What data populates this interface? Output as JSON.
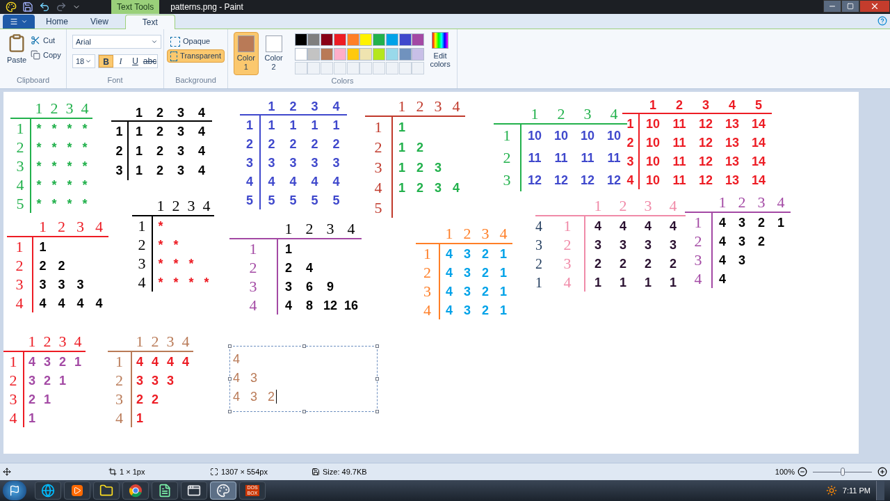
{
  "title_bar": {
    "title": "patterns.png - Paint",
    "context_tab": "Text Tools"
  },
  "tabs": [
    {
      "label": "Home",
      "selected": false
    },
    {
      "label": "View",
      "selected": false
    },
    {
      "label": "Text",
      "selected": true
    }
  ],
  "clipboard": {
    "label": "Clipboard",
    "paste": "Paste",
    "cut": "Cut",
    "copy": "Copy"
  },
  "font": {
    "label": "Font",
    "family": "Arial",
    "size": "18",
    "styles": [
      {
        "kind": "bold",
        "label": "B",
        "selected": true
      },
      {
        "kind": "italic",
        "label": "I",
        "selected": false
      },
      {
        "kind": "underline",
        "label": "U",
        "selected": false
      },
      {
        "kind": "strike",
        "label": "abc",
        "selected": false
      }
    ]
  },
  "background": {
    "label": "Background",
    "options": [
      {
        "label": "Opaque",
        "selected": false
      },
      {
        "label": "Transparent",
        "selected": true
      }
    ]
  },
  "colors": {
    "label": "Colors",
    "slots": [
      {
        "label": "Color 1",
        "color": "#b97a57",
        "selected": true
      },
      {
        "label": "Color 2",
        "color": "#ffffff",
        "selected": false
      }
    ],
    "palette": [
      {
        "color": "#000000"
      },
      {
        "color": "#7f7f7f"
      },
      {
        "color": "#880015"
      },
      {
        "color": "#ed1c24"
      },
      {
        "color": "#ff7f27"
      },
      {
        "color": "#fff200"
      },
      {
        "color": "#22b14c"
      },
      {
        "color": "#00a2e8"
      },
      {
        "color": "#3f48cc"
      },
      {
        "color": "#a349a4"
      },
      {
        "color": "#ffffff"
      },
      {
        "color": "#c3c3c3"
      },
      {
        "color": "#b97a57"
      },
      {
        "color": "#ffaec9"
      },
      {
        "color": "#ffc90e"
      },
      {
        "color": "#efe4b0"
      },
      {
        "color": "#b5e61d"
      },
      {
        "color": "#99d9ea"
      },
      {
        "color": "#7092be"
      },
      {
        "color": "#c8bfe7"
      }
    ],
    "edit": "Edit colors"
  },
  "canvas": {
    "patterns": [
      {
        "kind": "handwritten",
        "header": {
          "color": "#22b14c",
          "labels": [
            "1",
            "2",
            "3",
            "4"
          ]
        },
        "labels": {
          "color": "#22b14c",
          "labels": [
            "1",
            "2",
            "3",
            "4",
            "5"
          ]
        },
        "color": "#22b14c",
        "rows": [
          [
            "*",
            "*",
            "*",
            "*"
          ],
          [
            "*",
            "*",
            "*",
            "*"
          ],
          [
            "*",
            "*",
            "*",
            "*"
          ],
          [
            "*",
            "*",
            "*",
            "*"
          ],
          [
            "*",
            "*",
            "*",
            "*"
          ]
        ]
      },
      {
        "kind": "typed",
        "header": {
          "color": "#000000",
          "labels": [
            "1",
            "2",
            "3",
            "4"
          ]
        },
        "labels": {
          "color": "#000000",
          "labels": [
            "1",
            "2",
            "3"
          ]
        },
        "color": "#000000",
        "rows": [
          [
            "1",
            "2",
            "3",
            "4"
          ],
          [
            "1",
            "2",
            "3",
            "4"
          ],
          [
            "1",
            "2",
            "3",
            "4"
          ]
        ]
      },
      {
        "kind": "typed",
        "header": {
          "color": "#3f48cc",
          "labels": [
            "1",
            "2",
            "3",
            "4"
          ]
        },
        "labels": {
          "color": "#3f48cc",
          "labels": [
            "1",
            "2",
            "3",
            "4",
            "5"
          ]
        },
        "color": "#3f48cc",
        "rows": [
          [
            "1",
            "1",
            "1",
            "1"
          ],
          [
            "2",
            "2",
            "2",
            "2"
          ],
          [
            "3",
            "3",
            "3",
            "3"
          ],
          [
            "4",
            "4",
            "4",
            "4"
          ],
          [
            "5",
            "5",
            "5",
            "5"
          ]
        ]
      },
      {
        "kind": "handwritten",
        "header": {
          "color": "#c0392b",
          "labels": [
            "1",
            "2",
            "3",
            "4"
          ]
        },
        "labels": {
          "color": "#c0392b",
          "labels": [
            "1",
            "2",
            "3",
            "4",
            "5"
          ]
        },
        "color": "#22b14c",
        "rows": [
          [
            "1"
          ],
          [
            "1",
            "2"
          ],
          [
            "1",
            "2",
            "3"
          ],
          [
            "1",
            "2",
            "3",
            "4"
          ]
        ]
      },
      {
        "kind": "handwritten",
        "header": {
          "color": "#22b14c",
          "labels": [
            "1",
            "2",
            "3",
            "4"
          ]
        },
        "labels": {
          "color": "#22b14c",
          "labels": [
            "1",
            "2",
            "3"
          ]
        },
        "color": "#3f48cc",
        "rows": [
          [
            "10",
            "10",
            "10",
            "10"
          ],
          [
            "11",
            "11",
            "11",
            "11"
          ],
          [
            "12",
            "12",
            "12",
            "12"
          ]
        ]
      },
      {
        "kind": "typed",
        "header": {
          "color": "#ed1c24",
          "labels": [
            "1",
            "2",
            "3",
            "4",
            "5"
          ]
        },
        "labels": {
          "color": "#ed1c24",
          "labels": [
            "1",
            "2",
            "3",
            "4"
          ]
        },
        "color": "#ed1c24",
        "rows": [
          [
            "10",
            "11",
            "12",
            "13",
            "14"
          ],
          [
            "10",
            "11",
            "12",
            "13",
            "14"
          ],
          [
            "10",
            "11",
            "12",
            "13",
            "14"
          ],
          [
            "10",
            "11",
            "12",
            "13",
            "14"
          ]
        ]
      },
      {
        "kind": "handwritten",
        "header": {
          "color": "#ed1c24",
          "labels": [
            "1",
            "2",
            "3",
            "4"
          ]
        },
        "labels": {
          "color": "#ed1c24",
          "labels": [
            "1",
            "2",
            "3",
            "4"
          ]
        },
        "color": "#000000",
        "rows": [
          [
            "1"
          ],
          [
            "2",
            "2"
          ],
          [
            "3",
            "3",
            "3"
          ],
          [
            "4",
            "4",
            "4",
            "4"
          ]
        ]
      },
      {
        "kind": "handwritten",
        "header": {
          "color": "#000000",
          "labels": [
            "1",
            "2",
            "3",
            "4"
          ]
        },
        "labels": {
          "color": "#000000",
          "labels": [
            "1",
            "2",
            "3",
            "4"
          ]
        },
        "color": "#ed1c24",
        "rows": [
          [
            "*"
          ],
          [
            "*",
            "*"
          ],
          [
            "*",
            "*",
            "*"
          ],
          [
            "*",
            "*",
            "*",
            "*"
          ]
        ]
      },
      {
        "kind": "handwritten",
        "header": {
          "color": "#000000",
          "labels": [
            "1",
            "2",
            "3",
            "4"
          ]
        },
        "labels": {
          "color": "#a349a4",
          "labels": [
            "1",
            "2",
            "3",
            "4"
          ]
        },
        "color": "#000000",
        "rows": [
          [
            "1"
          ],
          [
            "2",
            "4"
          ],
          [
            "3",
            "6",
            "9"
          ],
          [
            "4",
            "8",
            "12",
            "16"
          ]
        ]
      },
      {
        "kind": "handwritten",
        "header": {
          "color": "#ff7f27",
          "labels": [
            "1",
            "2",
            "3",
            "4"
          ]
        },
        "labels": {
          "color": "#ff7f27",
          "labels": [
            "1",
            "2",
            "3",
            "4"
          ]
        },
        "color": "#00a2e8",
        "rows": [
          [
            "4",
            "3",
            "2",
            "1"
          ],
          [
            "4",
            "3",
            "2",
            "1"
          ],
          [
            "4",
            "3",
            "2",
            "1"
          ],
          [
            "4",
            "3",
            "2",
            "1"
          ]
        ]
      },
      {
        "kind": "handwritten",
        "header": {
          "color": "#f08aa8",
          "labels": [
            "1",
            "2",
            "3",
            "4"
          ]
        },
        "outer_labels": [
          "4",
          "3",
          "2",
          "1"
        ],
        "labels": {
          "color": "#f08aa8",
          "labels": [
            "1",
            "2",
            "3",
            "4"
          ]
        },
        "color": "#2a1030",
        "rows": [
          [
            "4",
            "4",
            "4",
            "4"
          ],
          [
            "3",
            "3",
            "3",
            "3"
          ],
          [
            "2",
            "2",
            "2",
            "2"
          ],
          [
            "1",
            "1",
            "1",
            "1"
          ]
        ]
      },
      {
        "kind": "handwritten",
        "header": {
          "color": "#a349a4",
          "labels": [
            "1",
            "2",
            "3",
            "4"
          ]
        },
        "labels": {
          "color": "#a349a4",
          "labels": [
            "1",
            "2",
            "3",
            "4"
          ]
        },
        "color": "#000000",
        "rows": [
          [
            "4",
            "3",
            "2",
            "1"
          ],
          [
            "4",
            "3",
            "2"
          ],
          [
            "4",
            "3"
          ],
          [
            "4"
          ]
        ]
      },
      {
        "kind": "handwritten",
        "header": {
          "color": "#ed1c24",
          "labels": [
            "1",
            "2",
            "3",
            "4"
          ]
        },
        "labels": {
          "color": "#ed1c24",
          "labels": [
            "1",
            "2",
            "3",
            "4"
          ]
        },
        "color": "#a349a4",
        "rows": [
          [
            "4",
            "3",
            "2",
            "1"
          ],
          [
            "3",
            "2",
            "1"
          ],
          [
            "2",
            "1"
          ],
          [
            "1"
          ]
        ]
      },
      {
        "kind": "handwritten",
        "header": {
          "color": "#b97a57",
          "labels": [
            "1",
            "2",
            "3",
            "4"
          ]
        },
        "labels": {
          "color": "#b97a57",
          "labels": [
            "1",
            "2",
            "3",
            "4"
          ]
        },
        "color": "#ed1c24",
        "rows": [
          [
            "4",
            "4",
            "4",
            "4"
          ],
          [
            "3",
            "3",
            "3"
          ],
          [
            "2",
            "2"
          ],
          [
            "1"
          ]
        ]
      }
    ],
    "text_box": {
      "color": "#b97a57",
      "lines": [
        [
          "4"
        ],
        [
          "4",
          "3"
        ],
        [
          "4",
          "3",
          "2"
        ]
      ]
    }
  },
  "status_bar": {
    "selection": "1 × 1px",
    "canvas_size": "1307 × 554px",
    "file_size": "Size: 49.7KB",
    "zoom": "100%",
    "level": 0.5
  },
  "taskbar": {
    "apps": [
      {
        "kind": "browser",
        "selected": false
      },
      {
        "kind": "media",
        "selected": false
      },
      {
        "kind": "folder",
        "selected": false
      },
      {
        "kind": "chrome",
        "selected": false
      },
      {
        "kind": "notepad",
        "selected": false
      },
      {
        "kind": "window",
        "selected": false
      },
      {
        "kind": "paint",
        "selected": true
      },
      {
        "kind": "dosbox",
        "label": "DOS BOX",
        "selected": false
      }
    ],
    "clock": "7:11 PM"
  }
}
